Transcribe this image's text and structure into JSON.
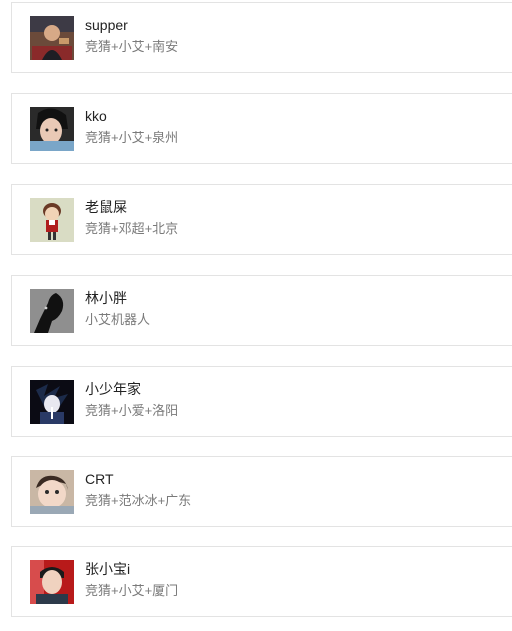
{
  "users": [
    {
      "name": "supper",
      "tags": "竞猜+小艾+南安",
      "avatar": "avatar-photo-person-icon"
    },
    {
      "name": "kko",
      "tags": "竞猜+小艾+泉州",
      "avatar": "avatar-photo-person-icon"
    },
    {
      "name": "老鼠屎",
      "tags": "竞猜+邓超+北京",
      "avatar": "avatar-cartoon-icon"
    },
    {
      "name": "林小胖",
      "tags": "小艾机器人",
      "avatar": "avatar-silhouette-icon"
    },
    {
      "name": "小少年家",
      "tags": "竞猜+小爱+洛阳",
      "avatar": "avatar-anime-icon"
    },
    {
      "name": "CRT",
      "tags": "竞猜+范冰冰+广东",
      "avatar": "avatar-photo-child-icon"
    },
    {
      "name": "张小宝i",
      "tags": "竞猜+小艾+厦门",
      "avatar": "avatar-photo-person-icon"
    }
  ]
}
